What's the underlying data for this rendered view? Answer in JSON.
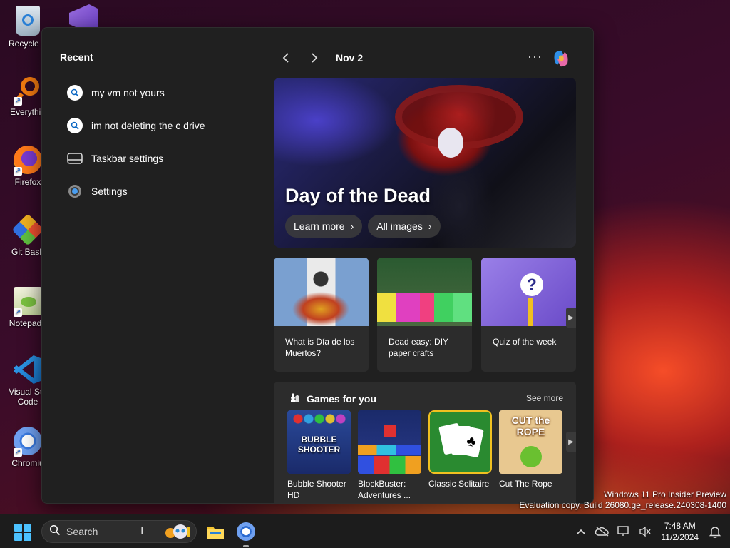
{
  "desktop": {
    "icons": [
      {
        "label": "Recycle B"
      },
      {
        "label": "Everythin"
      },
      {
        "label": "Firefox"
      },
      {
        "label": "Git Bash"
      },
      {
        "label": "Notepad+"
      },
      {
        "label": "Visual Stu",
        "label2": "Code"
      },
      {
        "label": "Chromiu"
      }
    ]
  },
  "widgets": {
    "recent_title": "Recent",
    "recent_items": [
      {
        "label": "my vm not yours",
        "icon": "search-icon"
      },
      {
        "label": "im not deleting the c drive",
        "icon": "search-icon"
      },
      {
        "label": "Taskbar settings",
        "icon": "taskbar-icon"
      },
      {
        "label": "Settings",
        "icon": "gear-icon"
      }
    ],
    "date": "Nov 2",
    "more_label": "···",
    "hero": {
      "title": "Day of the Dead",
      "learn_more": "Learn more",
      "all_images": "All images"
    },
    "cards": [
      {
        "title": "What is Día de los Muertos?"
      },
      {
        "title": "Dead easy: DIY paper crafts"
      },
      {
        "title": "Quiz of the week"
      }
    ],
    "games": {
      "title": "Games for you",
      "see_more": "See more",
      "items": [
        {
          "name": "Bubble Shooter HD",
          "tile_text": "BUBBLE SHOOTER"
        },
        {
          "name": "BlockBuster: Adventures ..."
        },
        {
          "name": "Classic Solitaire"
        },
        {
          "name": "Cut The Rope",
          "tile_text": "CUT the ROPE"
        }
      ]
    }
  },
  "watermark": {
    "line1": "Windows 11 Pro Insider Preview",
    "line2": "Evaluation copy. Build 26080.ge_release.240308-1400"
  },
  "taskbar": {
    "search_placeholder": "Search",
    "clock_time": "7:48 AM",
    "clock_date": "11/2/2024"
  },
  "colors": {
    "accent": "#4cc2ff",
    "panel_bg": "#202020",
    "card_bg": "#2c2c2c"
  }
}
